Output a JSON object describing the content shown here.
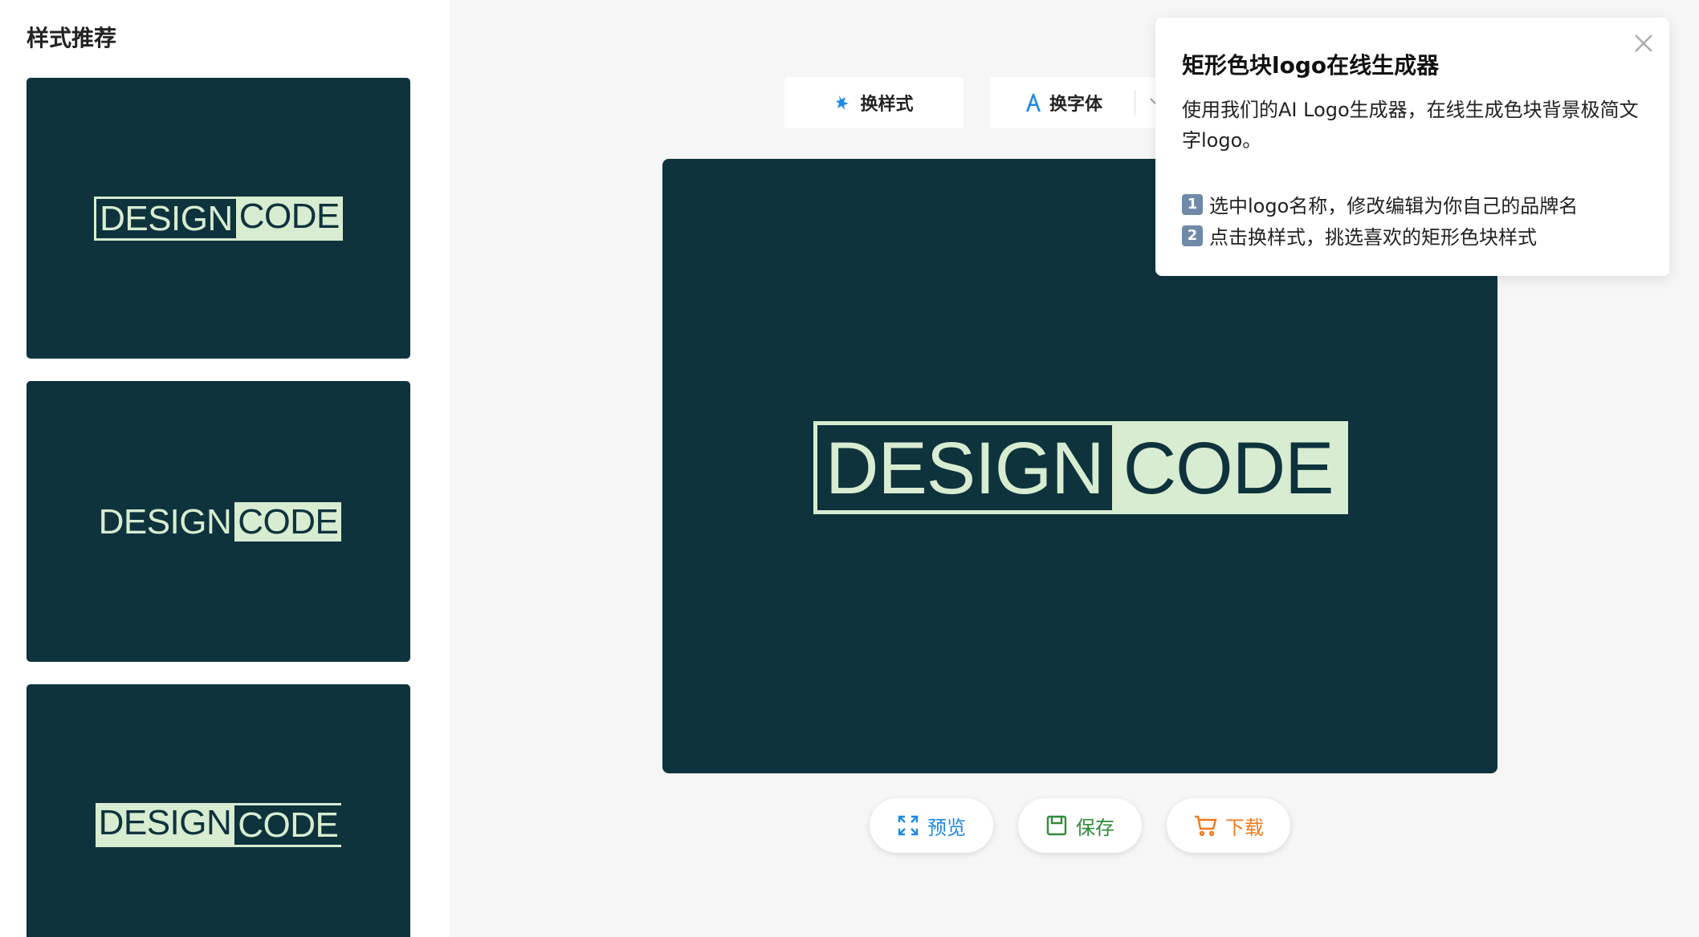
{
  "sidebar": {
    "title": "样式推荐",
    "cards": [
      {
        "word1": "DESIGN",
        "word2": "CODE"
      },
      {
        "word1": "DESIGN",
        "word2": "CODE"
      },
      {
        "word1": "DESIGN",
        "word2": "CODE"
      }
    ]
  },
  "toolbar": {
    "style_label": "换样式",
    "font_label": "换字体"
  },
  "canvas": {
    "word1": "DESIGN",
    "word2": "CODE",
    "background": "#0e333d",
    "accent": "#d8ecd1"
  },
  "actions": {
    "preview_label": "预览",
    "save_label": "保存",
    "download_label": "下载"
  },
  "popover": {
    "title": "矩形色块logo在线生成器",
    "description": "使用我们的AI Logo生成器，在线生成色块背景极简文字logo。",
    "steps": [
      {
        "num": "1",
        "text": "选中logo名称，修改编辑为你自己的品牌名"
      },
      {
        "num": "2",
        "text": "点击换样式，挑选喜欢的矩形色块样式"
      }
    ]
  }
}
